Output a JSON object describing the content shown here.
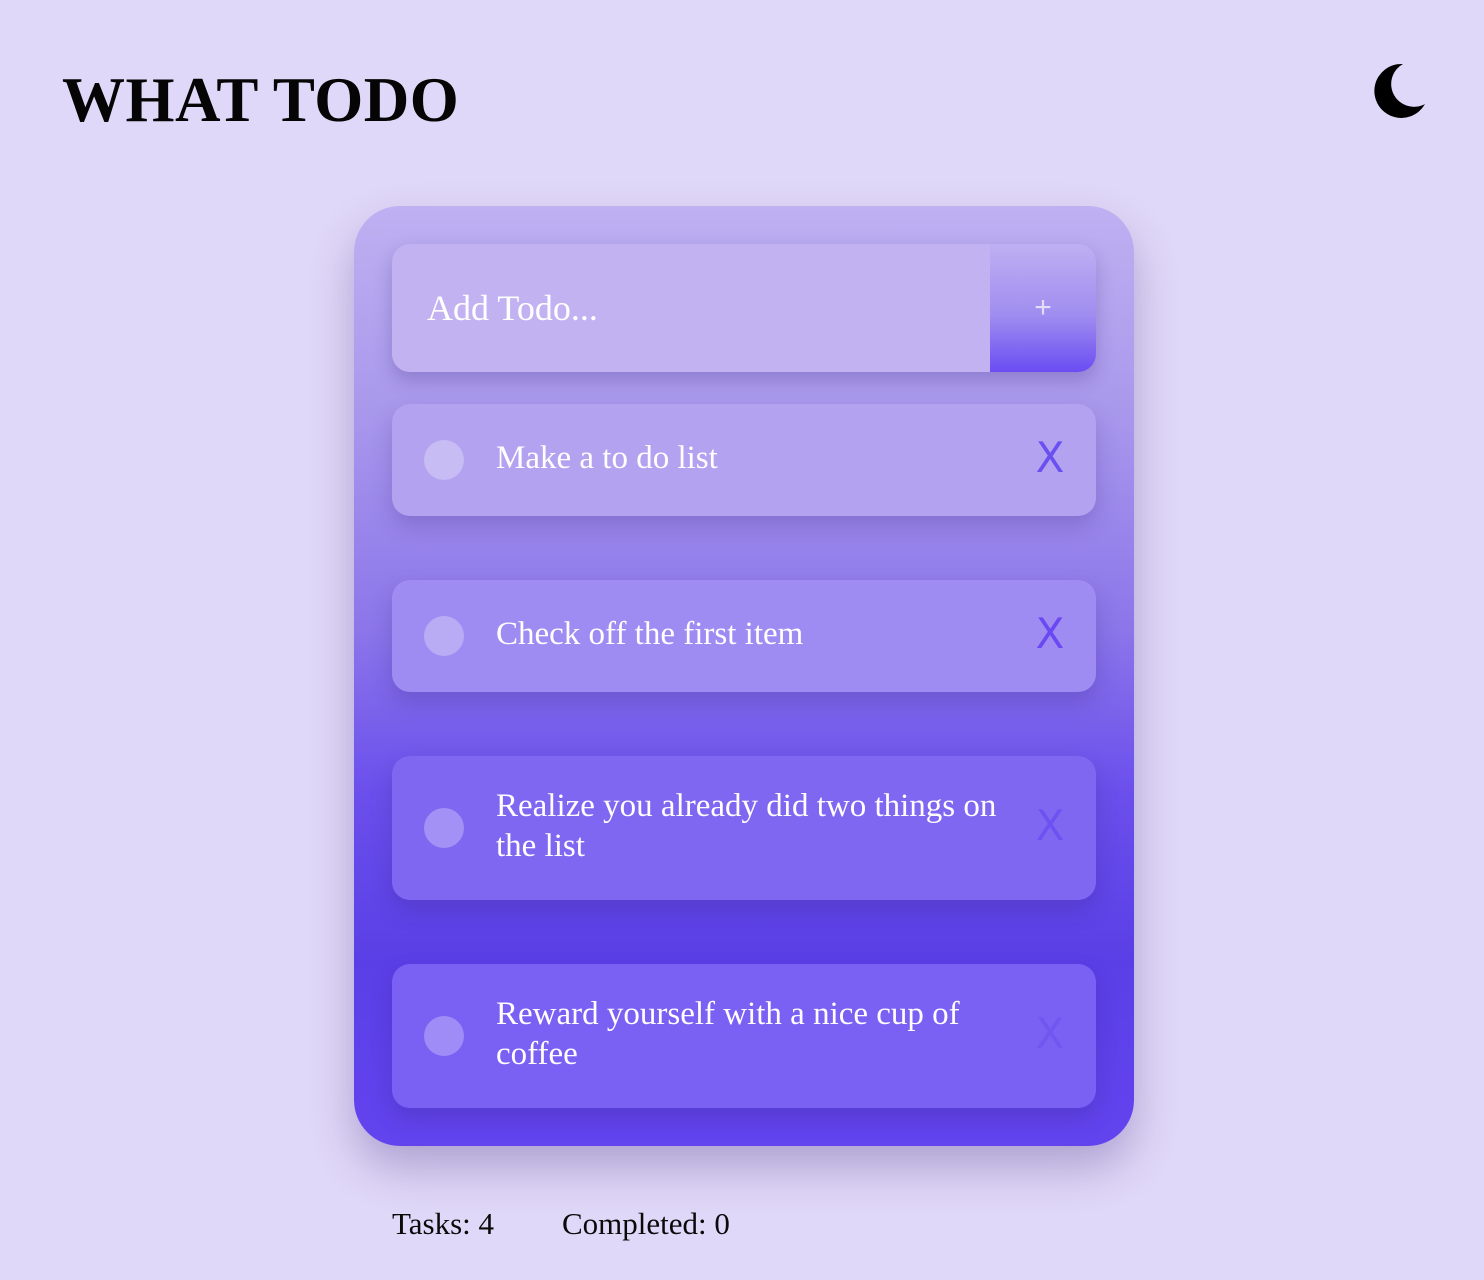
{
  "header": {
    "title": "WHAT TODO"
  },
  "theme_toggle": {
    "icon": "moon-icon"
  },
  "add_form": {
    "placeholder": "Add Todo...",
    "button_label": "+"
  },
  "todos": [
    {
      "text": "Make a to do list",
      "delete_label": "X",
      "completed": false
    },
    {
      "text": "Check off the first item",
      "delete_label": "X",
      "completed": false
    },
    {
      "text": "Realize you already did two things on the list",
      "delete_label": "X",
      "completed": false
    },
    {
      "text": "Reward yourself with a nice cup of coffee",
      "delete_label": "X",
      "completed": false
    }
  ],
  "stats": {
    "tasks": "Tasks: 4",
    "completed": "Completed: 0"
  },
  "colors": {
    "background": "#e0d8f8",
    "accent": "#6a4df2",
    "card_top": "#bfb0f2",
    "card_bottom": "#5a3fe6"
  }
}
